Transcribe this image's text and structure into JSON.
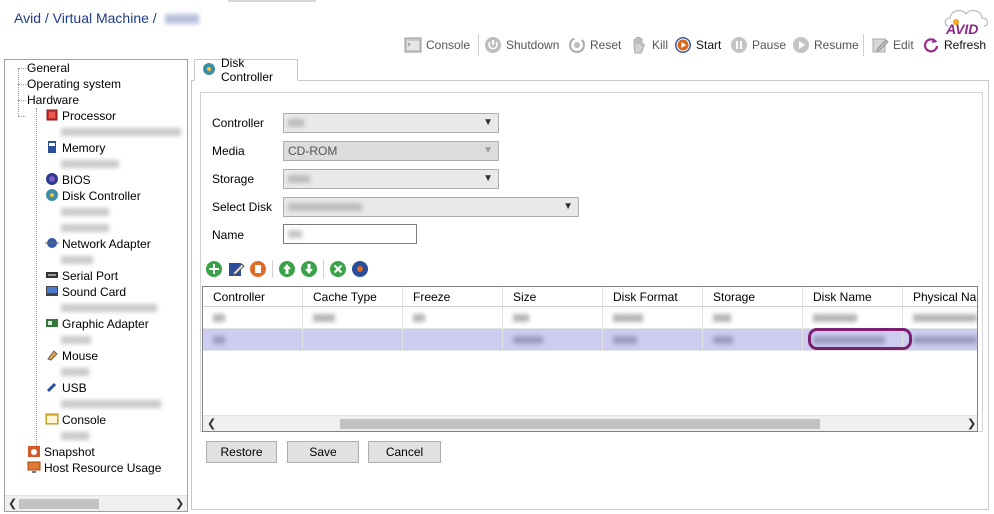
{
  "breadcrumb": {
    "part1": "Avid",
    "sep1": "/",
    "part2": "Virtual Machine",
    "sep2": "/"
  },
  "logo": {
    "text": "AVID"
  },
  "toolbar": {
    "console": "Console",
    "shutdown": "Shutdown",
    "reset": "Reset",
    "kill": "Kill",
    "start": "Start",
    "pause": "Pause",
    "resume": "Resume",
    "edit": "Edit",
    "refresh": "Refresh"
  },
  "tree": {
    "general": "General",
    "os": "Operating system",
    "hardware": "Hardware",
    "processor": "Processor",
    "memory": "Memory",
    "bios": "BIOS",
    "disk_controller": "Disk Controller",
    "network_adapter": "Network Adapter",
    "serial_port": "Serial Port",
    "sound_card": "Sound Card",
    "graphic_adapter": "Graphic Adapter",
    "mouse": "Mouse",
    "usb": "USB",
    "console": "Console",
    "snapshot": "Snapshot",
    "host_resource_usage": "Host Resource Usage"
  },
  "tab": {
    "label": "Disk Controller"
  },
  "form": {
    "controller_label": "Controller",
    "media_label": "Media",
    "media_value": "CD-ROM",
    "storage_label": "Storage",
    "select_disk_label": "Select Disk",
    "name_label": "Name"
  },
  "grid": {
    "headers": [
      "Controller",
      "Cache Type",
      "Freeze",
      "Size",
      "Disk Format",
      "Storage",
      "Disk Name",
      "Physical Nam"
    ]
  },
  "buttons": {
    "restore": "Restore",
    "save": "Save",
    "cancel": "Cancel"
  },
  "colors": {
    "accent": "#1f3b8a",
    "selection": "#cdcdf2",
    "highlight": "#7b1f6e"
  }
}
